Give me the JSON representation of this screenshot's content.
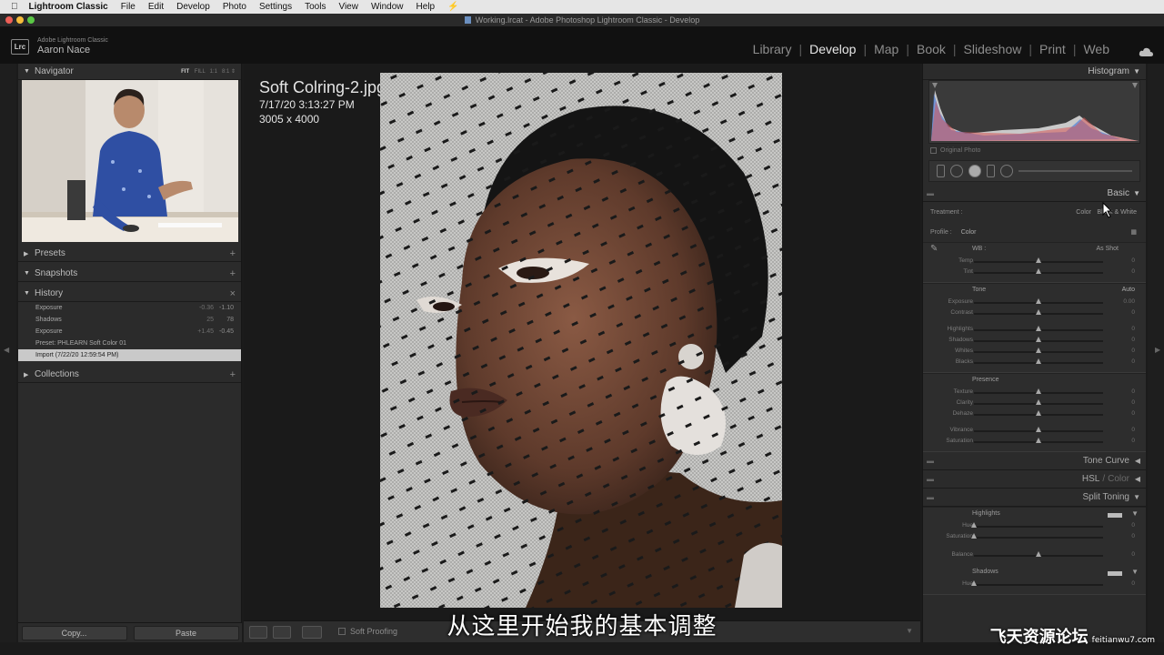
{
  "menubar": {
    "app_name": "Lightroom Classic",
    "items": [
      "File",
      "Edit",
      "Develop",
      "Photo",
      "Settings",
      "Tools",
      "View",
      "Window",
      "Help"
    ]
  },
  "window": {
    "title": "Working.lrcat - Adobe Photoshop Lightroom Classic - Develop"
  },
  "identity": {
    "app_label": "Adobe Lightroom Classic",
    "user": "Aaron Nace",
    "badge": "Lrc"
  },
  "modules": [
    "Library",
    "Develop",
    "Map",
    "Book",
    "Slideshow",
    "Print",
    "Web"
  ],
  "active_module": "Develop",
  "left_panel": {
    "navigator": {
      "title": "Navigator",
      "zoom_options": [
        "FIT",
        "FILL",
        "1:1",
        "8:1"
      ]
    },
    "presets": {
      "title": "Presets"
    },
    "snapshots": {
      "title": "Snapshots"
    },
    "history": {
      "title": "History",
      "items": [
        {
          "label": "Exposure",
          "v1": "-0.36",
          "v2": "-1.10"
        },
        {
          "label": "Shadows",
          "v1": "25",
          "v2": "78"
        },
        {
          "label": "Exposure",
          "v1": "+1.45",
          "v2": "-0.45"
        },
        {
          "label": "Preset: PHLEARN Soft Color 01",
          "v1": "",
          "v2": ""
        },
        {
          "label": "Import (7/22/20 12:59:54 PM)",
          "v1": "",
          "v2": ""
        }
      ]
    },
    "collections": {
      "title": "Collections"
    },
    "copy_label": "Copy...",
    "paste_label": "Paste"
  },
  "photo": {
    "filename": "Soft Colring-2.jpg",
    "datetime": "7/17/20 3:13:27 PM",
    "dimensions": "3005 x 4000"
  },
  "toolbar": {
    "soft_proofing": "Soft Proofing"
  },
  "right_panel": {
    "histogram": {
      "title": "Histogram",
      "original_photo": "Original Photo"
    },
    "basic": {
      "title": "Basic",
      "treatment_label": "Treatment :",
      "treatment_color": "Color",
      "treatment_bw": "Black & White",
      "profile_label": "Profile :",
      "profile_value": "Color",
      "wb_label": "WB :",
      "wb_value": "As Shot",
      "tone_label": "Tone",
      "auto_label": "Auto",
      "presence_label": "Presence",
      "wb_sliders": [
        {
          "label": "Temp",
          "value": "0",
          "pos": 0.5
        },
        {
          "label": "Tint",
          "value": "0",
          "pos": 0.5
        }
      ],
      "tone_sliders": [
        {
          "label": "Exposure",
          "value": "0.00",
          "pos": 0.5
        },
        {
          "label": "Contrast",
          "value": "0",
          "pos": 0.5
        }
      ],
      "tone_sliders_2": [
        {
          "label": "Highlights",
          "value": "0",
          "pos": 0.5
        },
        {
          "label": "Shadows",
          "value": "0",
          "pos": 0.5
        },
        {
          "label": "Whites",
          "value": "0",
          "pos": 0.5
        },
        {
          "label": "Blacks",
          "value": "0",
          "pos": 0.5
        }
      ],
      "presence_sliders": [
        {
          "label": "Texture",
          "value": "0",
          "pos": 0.5
        },
        {
          "label": "Clarity",
          "value": "0",
          "pos": 0.5
        },
        {
          "label": "Dehaze",
          "value": "0",
          "pos": 0.5
        }
      ],
      "presence_sliders_2": [
        {
          "label": "Vibrance",
          "value": "0",
          "pos": 0.5
        },
        {
          "label": "Saturation",
          "value": "0",
          "pos": 0.5
        }
      ]
    },
    "tone_curve": {
      "title": "Tone Curve"
    },
    "hsl": {
      "title": "HSL",
      "sep": "/",
      "color": "Color"
    },
    "split_toning": {
      "title": "Split Toning",
      "highlights_label": "Highlights",
      "shadows_label": "Shadows",
      "highlight_sliders": [
        {
          "label": "Hue",
          "value": "0",
          "pos": 0.0
        },
        {
          "label": "Saturation",
          "value": "0",
          "pos": 0.0
        }
      ],
      "balance": {
        "label": "Balance",
        "value": "0",
        "pos": 0.5
      },
      "shadow_sliders": [
        {
          "label": "Hue",
          "value": "0",
          "pos": 0.0
        }
      ]
    }
  },
  "overlay": {
    "subtitle": "从这里开始我的基本调整",
    "watermark_cn": "飞天资源论坛",
    "watermark_url": "feitianwu7.com"
  },
  "colors": {
    "panel": "#2b2b2b",
    "accent_text": "#e8e8e8",
    "background": "#1a1a1a"
  }
}
